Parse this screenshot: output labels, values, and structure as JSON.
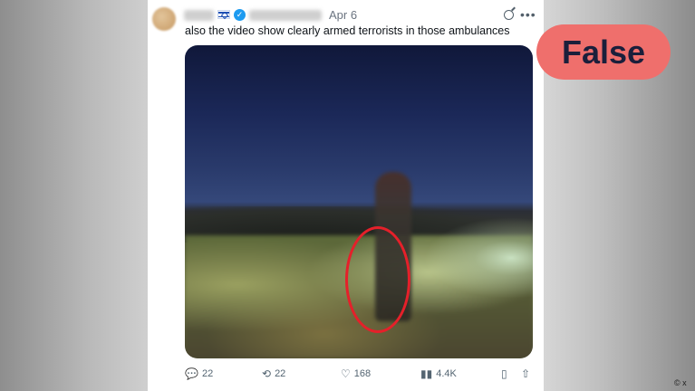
{
  "post": {
    "date": "Apr 6",
    "text": "also the video show clearly armed terrorists in those ambulances"
  },
  "icons": {
    "verified": "verified-badge-icon",
    "flag": "israel-flag-icon",
    "grok": "grok-icon",
    "more": "more-icon",
    "reply": "reply-icon",
    "repost": "repost-icon",
    "like": "like-icon",
    "views": "views-icon",
    "bookmark": "bookmark-icon",
    "share": "share-icon"
  },
  "actions": {
    "replies": "22",
    "reposts": "22",
    "likes": "168",
    "views": "4.4K"
  },
  "verdict": {
    "label": "False",
    "color": "#ef6f6c"
  },
  "credit": "© x",
  "colors": {
    "verified": "#1d9bf0",
    "annotation_circle": "#e5202a"
  }
}
